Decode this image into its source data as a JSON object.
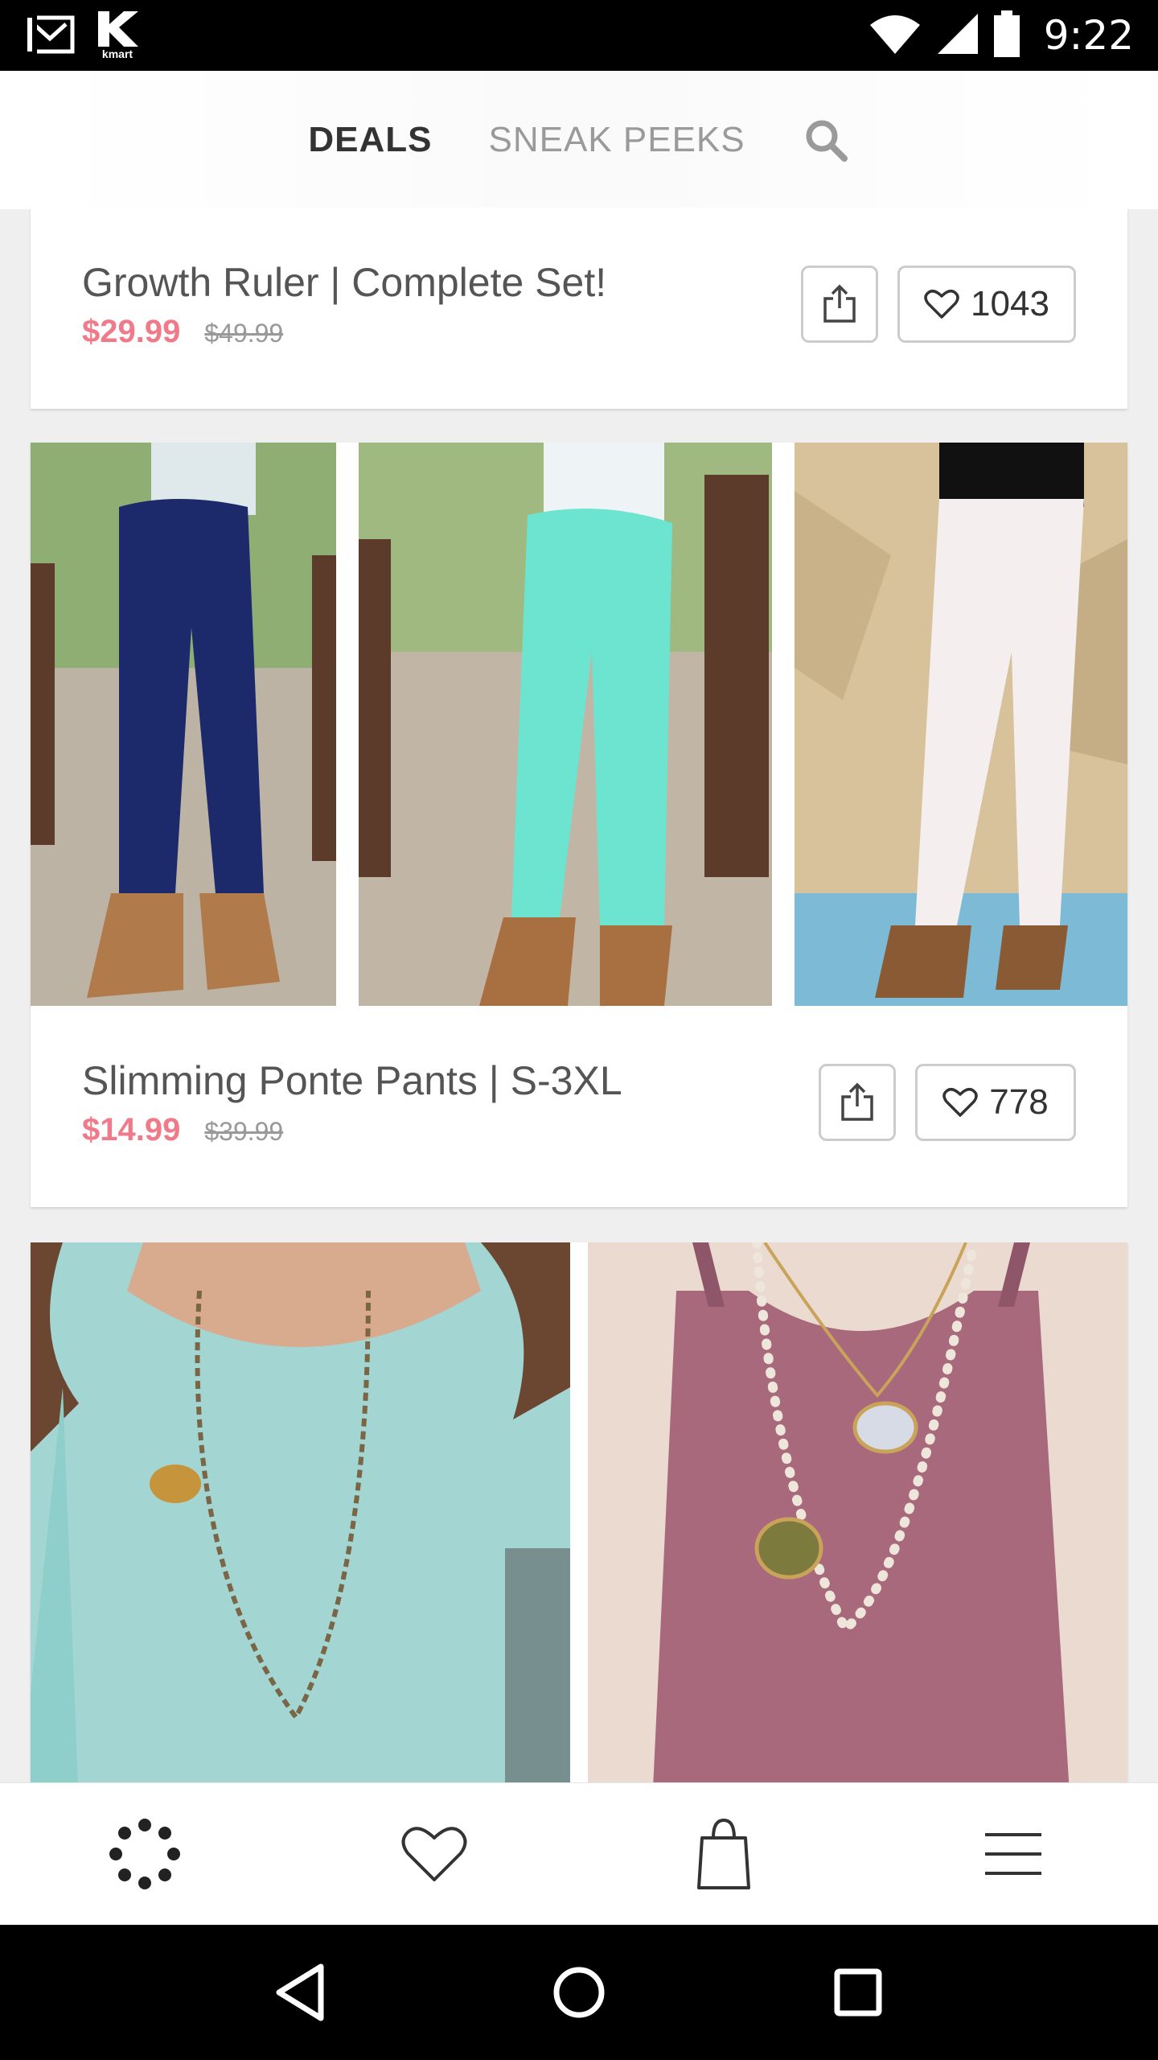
{
  "status_bar": {
    "time": "9:22",
    "left_icons": [
      "gmail-icon",
      "kmart-icon"
    ],
    "kmart_label": "kmart",
    "right_icons": [
      "wifi-icon",
      "signal-icon",
      "battery-icon"
    ]
  },
  "header": {
    "tabs": [
      {
        "label": "DEALS",
        "active": true
      },
      {
        "label": "SNEAK PEEKS",
        "active": false
      }
    ],
    "search_icon": "search-icon"
  },
  "products": [
    {
      "title": "Growth Ruler | Complete Set!",
      "price": "$29.99",
      "original_price": "$49.99",
      "likes": "1043",
      "share_icon": "share-icon",
      "like_icon": "heart-icon"
    },
    {
      "title": "Slimming Ponte Pants | S-3XL",
      "price": "$14.99",
      "original_price": "$39.99",
      "likes": "778",
      "share_icon": "share-icon",
      "like_icon": "heart-icon",
      "images": [
        "navy-pants-image",
        "mint-pants-image",
        "white-pants-image"
      ]
    },
    {
      "images": [
        "teal-top-necklace-image",
        "mauve-top-necklace-image"
      ]
    }
  ],
  "bottom_nav": [
    {
      "icon": "dots-circle-icon"
    },
    {
      "icon": "heart-icon"
    },
    {
      "icon": "shopping-bag-icon"
    },
    {
      "icon": "menu-icon"
    }
  ],
  "android_nav": [
    "back-icon",
    "home-icon",
    "recents-icon"
  ],
  "colors": {
    "price": "#f07a8a",
    "active_tab": "#333333",
    "inactive_tab": "#9a9a9a"
  }
}
